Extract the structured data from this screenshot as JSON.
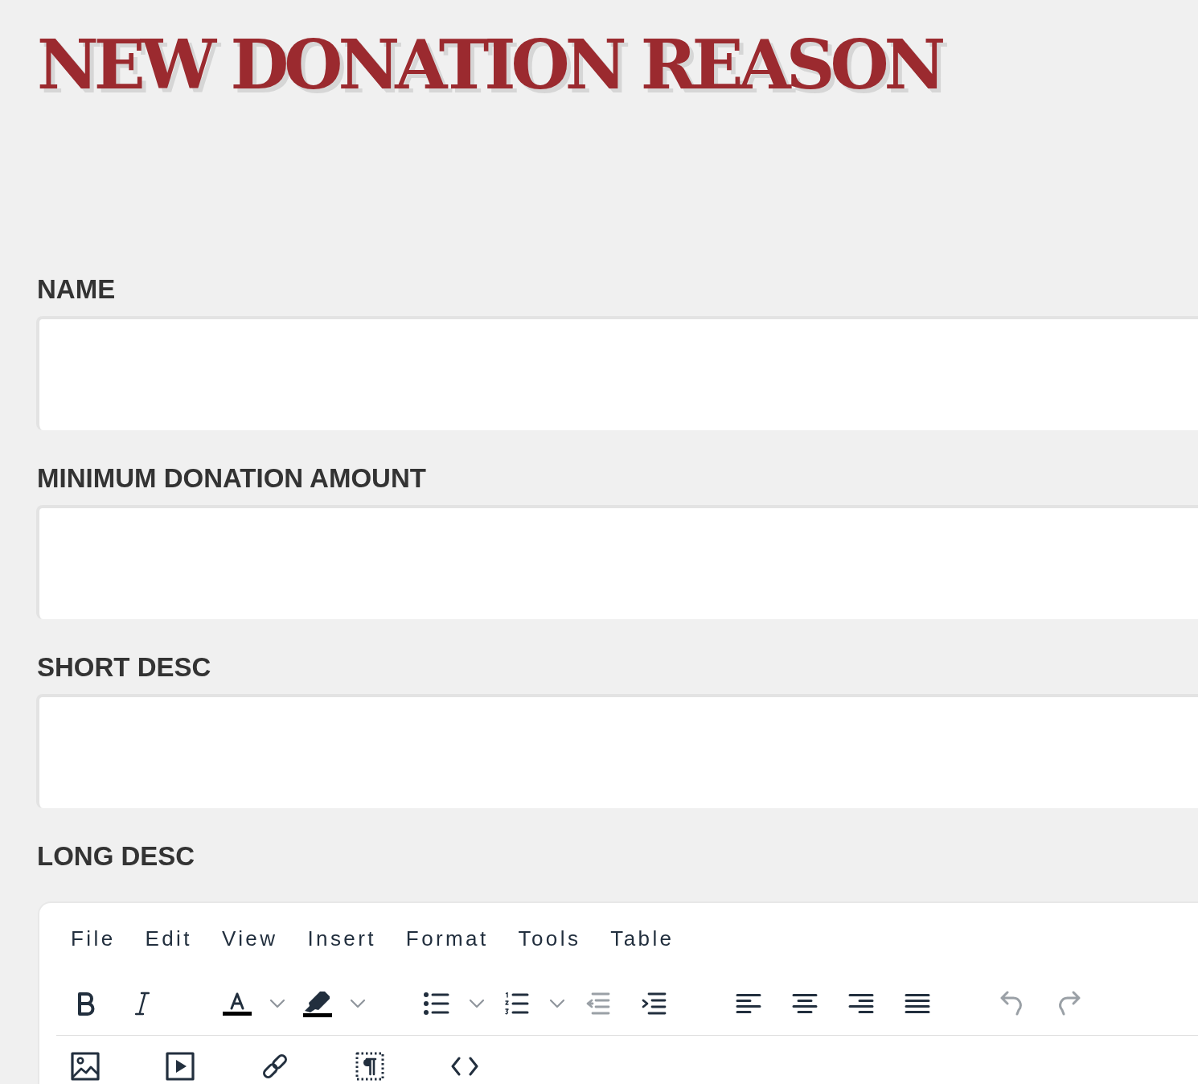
{
  "title": "NEW DONATION REASON",
  "fields": [
    {
      "label": "NAME"
    },
    {
      "label": "MINIMUM DONATION AMOUNT"
    },
    {
      "label": "SHORT DESC"
    }
  ],
  "long_desc": {
    "label": "LONG DESC",
    "menu": [
      "File",
      "Edit",
      "View",
      "Insert",
      "Format",
      "Tools",
      "Table"
    ],
    "toolbar": [
      {
        "groups": [
          {
            "buttons": [
              {
                "kind": "bold",
                "disabled": false
              },
              {
                "kind": "italic",
                "disabled": false
              }
            ]
          },
          {
            "buttons": [
              {
                "kind": "forecolor",
                "disabled": false
              },
              {
                "kind": "backcolor",
                "disabled": false
              }
            ]
          },
          {
            "buttons": [
              {
                "kind": "bullist",
                "disabled": false
              },
              {
                "kind": "numlist",
                "disabled": false
              },
              {
                "kind": "outdent",
                "disabled": true
              },
              {
                "kind": "indent",
                "disabled": false
              }
            ]
          },
          {
            "buttons": [
              {
                "kind": "alignleft",
                "disabled": false
              },
              {
                "kind": "aligncenter",
                "disabled": false
              },
              {
                "kind": "alignright",
                "disabled": false
              },
              {
                "kind": "alignjustify",
                "disabled": false
              }
            ]
          },
          {
            "buttons": [
              {
                "kind": "undo",
                "disabled": true
              },
              {
                "kind": "redo",
                "disabled": true
              }
            ]
          }
        ]
      },
      {
        "groups": [
          {
            "buttons": [
              {
                "kind": "image",
                "disabled": false
              }
            ]
          },
          {
            "buttons": [
              {
                "kind": "media",
                "disabled": false
              }
            ]
          },
          {
            "buttons": [
              {
                "kind": "link",
                "disabled": false
              }
            ]
          },
          {
            "buttons": [
              {
                "kind": "visualblocks",
                "disabled": false
              }
            ]
          },
          {
            "buttons": [
              {
                "kind": "code",
                "disabled": false
              }
            ]
          }
        ]
      }
    ]
  }
}
